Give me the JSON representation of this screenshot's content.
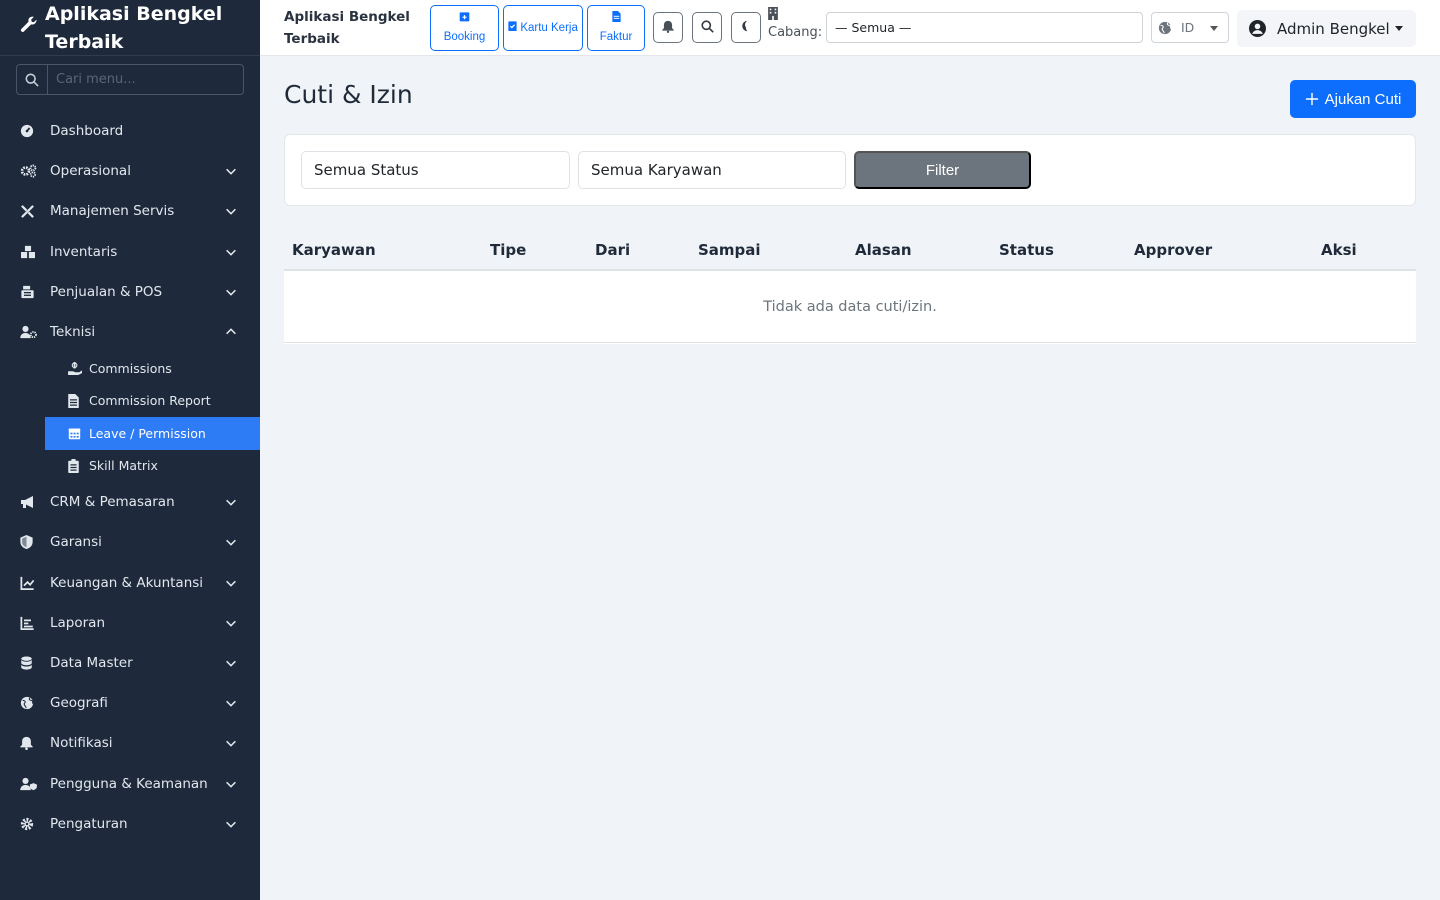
{
  "sidebar": {
    "brand": "Aplikasi Bengkel Terbaik",
    "search_placeholder": "Cari menu...",
    "items": [
      {
        "label": "Dashboard",
        "icon": "gauge-icon",
        "expandable": false
      },
      {
        "label": "Operasional",
        "icon": "cogs-icon",
        "expandable": true
      },
      {
        "label": "Manajemen Servis",
        "icon": "tools-icon",
        "expandable": true
      },
      {
        "label": "Inventaris",
        "icon": "boxes-icon",
        "expandable": true
      },
      {
        "label": "Penjualan & POS",
        "icon": "cash-register-icon",
        "expandable": true
      },
      {
        "label": "Teknisi",
        "icon": "user-cog-icon",
        "expandable": true,
        "expanded": true
      }
    ],
    "teknisi_sub": [
      {
        "label": "Commissions",
        "icon": "hand-holding-dollar-icon"
      },
      {
        "label": "Commission Report",
        "icon": "file-invoice-icon"
      },
      {
        "label": "Leave / Permission",
        "icon": "calendar-icon",
        "active": true
      },
      {
        "label": "Skill Matrix",
        "icon": "clipboard-list-icon"
      }
    ],
    "items_after": [
      {
        "label": "CRM & Pemasaran",
        "icon": "bullhorn-icon"
      },
      {
        "label": "Garansi",
        "icon": "shield-icon"
      },
      {
        "label": "Keuangan & Akuntansi",
        "icon": "chart-line-icon"
      },
      {
        "label": "Laporan",
        "icon": "bar-chart-icon"
      },
      {
        "label": "Data Master",
        "icon": "database-icon"
      },
      {
        "label": "Geografi",
        "icon": "globe-icon"
      },
      {
        "label": "Notifikasi",
        "icon": "bell-icon"
      },
      {
        "label": "Pengguna & Keamanan",
        "icon": "user-shield-icon"
      },
      {
        "label": "Pengaturan",
        "icon": "gear-icon"
      }
    ]
  },
  "topbar": {
    "title": "Aplikasi Bengkel Terbaik",
    "quick_buttons": [
      {
        "label": "Booking",
        "icon": "calendar-plus-icon"
      },
      {
        "label": "Kartu Kerja",
        "icon": "clipboard-check-icon"
      },
      {
        "label": "Faktur",
        "icon": "file-invoice-icon"
      }
    ],
    "cabang_label": "Cabang:",
    "cabang_value": "— Semua —",
    "language_value": "ID",
    "user_name": "Admin Bengkel"
  },
  "main": {
    "page_title": "Cuti & Izin",
    "primary_button": "Ajukan Cuti",
    "filters": {
      "status_value": "Semua Status",
      "employee_value": "Semua Karyawan",
      "filter_button": "Filter"
    },
    "table": {
      "columns": [
        "Karyawan",
        "Tipe",
        "Dari",
        "Sampai",
        "Alasan",
        "Status",
        "Approver",
        "Aksi"
      ],
      "empty_text": "Tidak ada data cuti/izin."
    }
  },
  "colors": {
    "sidebar_bg": "#1e2a3b",
    "active_item": "#2e7bf6",
    "primary": "#0d6efd",
    "secondary": "#6c757d",
    "page_bg": "#f0f3f7"
  }
}
